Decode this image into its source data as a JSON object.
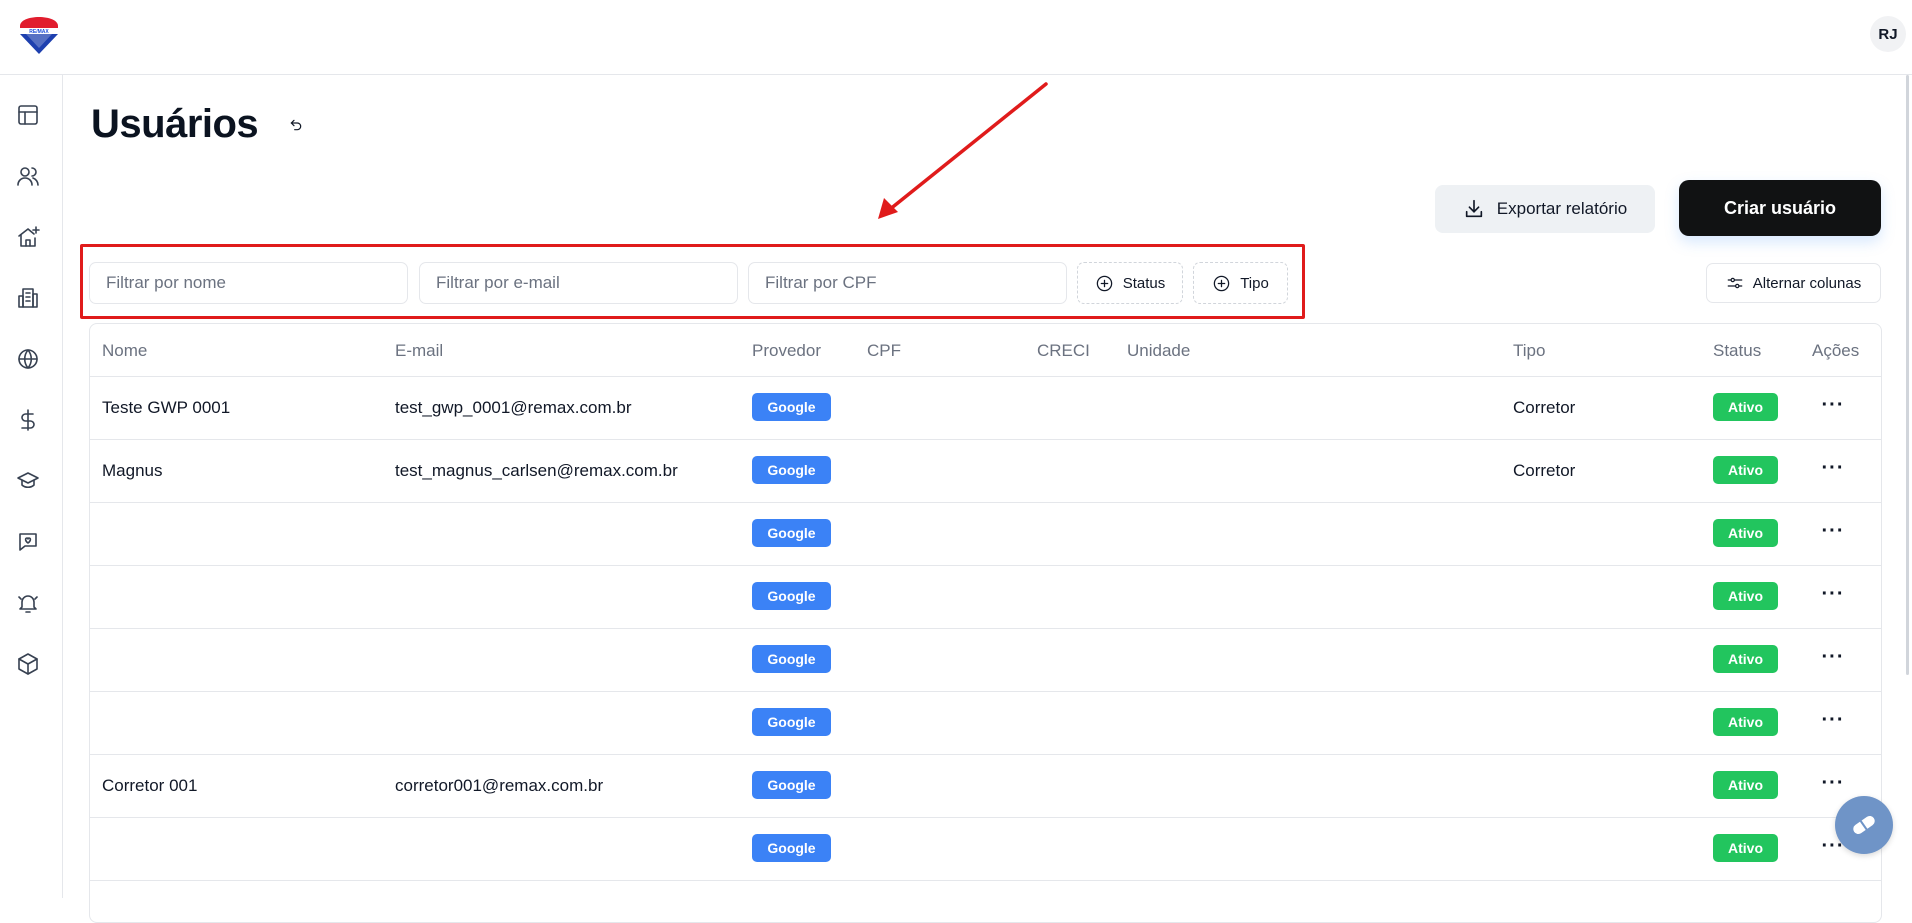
{
  "header": {
    "user_initials": "RJ"
  },
  "sidebar": {
    "items": [
      {
        "icon": "layout-icon"
      },
      {
        "icon": "users-icon"
      },
      {
        "icon": "home-plus-icon"
      },
      {
        "icon": "building-icon"
      },
      {
        "icon": "globe-icon"
      },
      {
        "icon": "dollar-icon"
      },
      {
        "icon": "graduation-cap-icon"
      },
      {
        "icon": "message-heart-icon"
      },
      {
        "icon": "bell-ring-icon"
      },
      {
        "icon": "box-icon"
      }
    ]
  },
  "page": {
    "title": "Usuários"
  },
  "toolbar": {
    "export_label": "Exportar relatório",
    "create_label": "Criar usuário",
    "columns_label": "Alternar colunas"
  },
  "filters": {
    "name_placeholder": "Filtrar por nome",
    "email_placeholder": "Filtrar por e-mail",
    "cpf_placeholder": "Filtrar por CPF",
    "status_label": "Status",
    "tipo_label": "Tipo"
  },
  "table": {
    "columns": {
      "nome": "Nome",
      "email": "E-mail",
      "provedor": "Provedor",
      "cpf": "CPF",
      "creci": "CRECI",
      "unidade": "Unidade",
      "tipo": "Tipo",
      "status": "Status",
      "acoes": "Ações"
    },
    "rows": [
      {
        "nome": "Teste GWP 0001",
        "email": "test_gwp_0001@remax.com.br",
        "provedor": "Google",
        "tipo": "Corretor",
        "status": "Ativo"
      },
      {
        "nome": "Magnus",
        "email": "test_magnus_carlsen@remax.com.br",
        "provedor": "Google",
        "tipo": "Corretor",
        "status": "Ativo"
      },
      {
        "nome": "",
        "email": "",
        "provedor": "Google",
        "tipo": "",
        "status": "Ativo"
      },
      {
        "nome": "",
        "email": "",
        "provedor": "Google",
        "tipo": "",
        "status": "Ativo"
      },
      {
        "nome": "",
        "email": "",
        "provedor": "Google",
        "tipo": "",
        "status": "Ativo"
      },
      {
        "nome": "",
        "email": "",
        "provedor": "Google",
        "tipo": "",
        "status": "Ativo"
      },
      {
        "nome": "Corretor 001",
        "email": "corretor001@remax.com.br",
        "provedor": "Google",
        "tipo": "",
        "status": "Ativo"
      },
      {
        "nome": "",
        "email": "",
        "provedor": "Google",
        "tipo": "",
        "status": "Ativo"
      }
    ],
    "actions_glyph": "···"
  },
  "colors": {
    "annotation_red": "#e01b1b",
    "google_badge": "#3b82f6",
    "ativo_badge": "#22c55e",
    "create_button": "#111213"
  }
}
